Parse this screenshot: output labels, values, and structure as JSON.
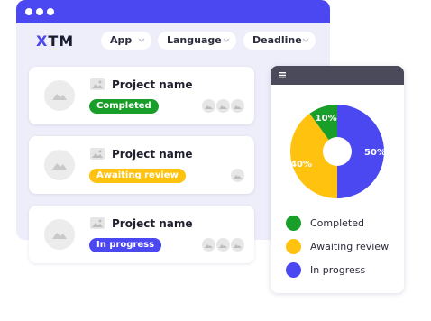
{
  "app": {
    "logo_x": "X",
    "logo_tm": "TM"
  },
  "filters": [
    {
      "label": "App"
    },
    {
      "label": "Language"
    },
    {
      "label": "Deadline"
    }
  ],
  "projects": [
    {
      "name": "Project name",
      "status": "Completed",
      "status_color": "#1a9e2a",
      "status_text_color": "#ffffff",
      "avatars": 3
    },
    {
      "name": "Project name",
      "status": "Awaiting review",
      "status_color": "#ffc20e",
      "status_text_color": "#ffffff",
      "avatars": 1
    },
    {
      "name": "Project name",
      "status": "In progress",
      "status_color": "#4b47f1",
      "status_text_color": "#ffffff",
      "avatars": 3
    }
  ],
  "chart_data": {
    "type": "pie",
    "donut": true,
    "categories": [
      "In progress",
      "Awaiting review",
      "Completed"
    ],
    "values": [
      50,
      40,
      10
    ],
    "data_labels": [
      "50%",
      "40%",
      "10%"
    ],
    "colors": [
      "#4b47f1",
      "#ffc20e",
      "#1a9e2a"
    ],
    "legend_position": "bottom"
  },
  "legend": [
    {
      "label": "Completed",
      "color": "#1a9e2a"
    },
    {
      "label": "Awaiting review",
      "color": "#ffc20e"
    },
    {
      "label": "In progress",
      "color": "#4b47f1"
    }
  ],
  "colors": {
    "accent": "#4b47f1",
    "window_bg": "#eeeefa",
    "chart_header": "#4a4a5a"
  },
  "icons": {
    "menu": "menu-icon",
    "image": "image-placeholder-icon",
    "avatar": "avatar-placeholder-icon",
    "chevron": "chevron-down-icon"
  }
}
